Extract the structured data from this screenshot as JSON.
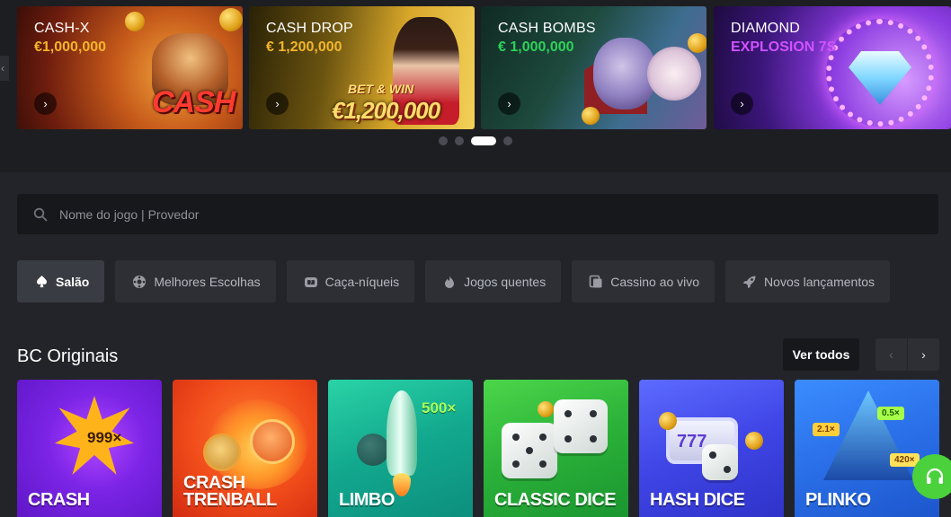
{
  "banners": [
    {
      "title": "CASH-X",
      "amount": "€1,000,000",
      "arrow": "›"
    },
    {
      "title": "CASH DROP",
      "amount": "€ 1,200,000",
      "art_text_1": "BET & WIN",
      "art_text_2": "€1,200,000",
      "arrow": "›"
    },
    {
      "title": "CASH BOMBS",
      "amount": "€ 1,000,000",
      "arrow": "›"
    },
    {
      "title": "DIAMOND",
      "amount": "EXPLOSION 7S",
      "arrow": "›"
    }
  ],
  "banner_art": {
    "cash_x_logo": "CASH"
  },
  "banner_prev": "‹",
  "carousel": {
    "total": 4,
    "active_index": 2
  },
  "search": {
    "placeholder": "Nome do jogo | Provedor",
    "value": ""
  },
  "tabs": [
    {
      "label": "Salão",
      "icon": "spade-icon",
      "active": true
    },
    {
      "label": "Melhores Escolhas",
      "icon": "wheel-icon",
      "active": false
    },
    {
      "label": "Caça-níqueis",
      "icon": "slot-icon",
      "active": false
    },
    {
      "label": "Jogos quentes",
      "icon": "flame-icon",
      "active": false
    },
    {
      "label": "Cassino ao vivo",
      "icon": "live-cards-icon",
      "active": false
    },
    {
      "label": "Novos lançamentos",
      "icon": "rocket-icon",
      "active": false
    }
  ],
  "section": {
    "title": "BC Originais",
    "see_all": "Ver todos",
    "prev": "‹",
    "next": "›"
  },
  "games": [
    {
      "name": "CRASH",
      "art_text": "999×"
    },
    {
      "name_line1": "CRASH",
      "name_line2": "TRENBALL"
    },
    {
      "name": "LIMBO",
      "art_text": "500×"
    },
    {
      "name": "CLASSIC DICE"
    },
    {
      "name": "HASH DICE",
      "art_text": "777"
    },
    {
      "name": "PLINKO",
      "tag1": "2.1×",
      "tag2": "0.5×",
      "tag3": "420×"
    }
  ],
  "colors": {
    "background": "#232429",
    "accent_green": "#4ad13b",
    "amount_gold": "#f3b62a",
    "amount_green": "#2ed35a",
    "amount_purple": "#d152ff"
  },
  "support": {
    "icon": "headset-icon"
  }
}
